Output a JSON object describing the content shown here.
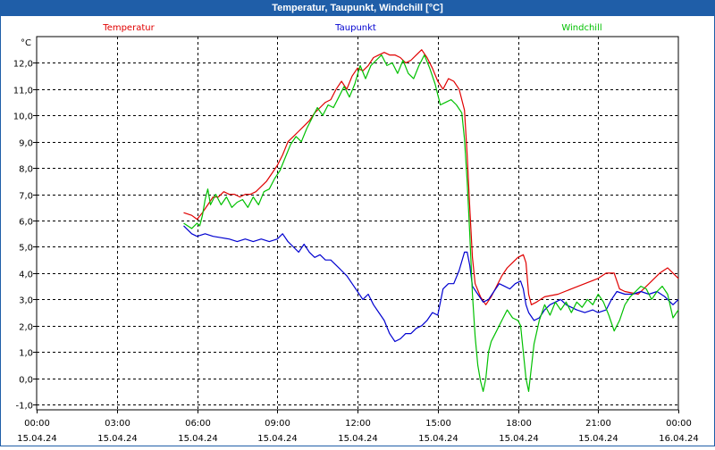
{
  "window": {
    "title": "Temperatur, Taupunkt, Windchill [°C]"
  },
  "chart_data": {
    "type": "line",
    "title": "Temperatur, Taupunkt, Windchill [°C]",
    "y_unit": "°C",
    "ylim": [
      -1.2,
      13.0
    ],
    "yticks": [
      -1.0,
      0.0,
      1.0,
      2.0,
      3.0,
      4.0,
      5.0,
      6.0,
      7.0,
      8.0,
      9.0,
      10.0,
      11.0,
      12.0
    ],
    "ytick_labels": [
      "-1,0",
      "0,0",
      "1,0",
      "2,0",
      "3,0",
      "4,0",
      "5,0",
      "6,0",
      "7,0",
      "8,0",
      "9,0",
      "10,0",
      "11,0",
      "12,0"
    ],
    "xlim": [
      0,
      24
    ],
    "xticks": [
      0,
      3,
      6,
      9,
      12,
      15,
      18,
      21,
      24
    ],
    "xtick_labels": [
      [
        "00:00",
        "15.04.24"
      ],
      [
        "03:00",
        "15.04.24"
      ],
      [
        "06:00",
        "15.04.24"
      ],
      [
        "09:00",
        "15.04.24"
      ],
      [
        "12:00",
        "15.04.24"
      ],
      [
        "15:00",
        "15.04.24"
      ],
      [
        "18:00",
        "15.04.24"
      ],
      [
        "21:00",
        "15.04.24"
      ],
      [
        "00:00",
        "16.04.24"
      ]
    ],
    "grid": true,
    "legend": "top",
    "series": [
      {
        "name": "Temperatur",
        "color": "#e00000",
        "points": [
          [
            5.5,
            6.3
          ],
          [
            5.8,
            6.2
          ],
          [
            6.0,
            6.05
          ],
          [
            6.2,
            6.3
          ],
          [
            6.4,
            6.6
          ],
          [
            6.6,
            6.9
          ],
          [
            6.8,
            6.9
          ],
          [
            7.0,
            7.1
          ],
          [
            7.2,
            7.0
          ],
          [
            7.4,
            7.0
          ],
          [
            7.6,
            6.9
          ],
          [
            7.8,
            7.0
          ],
          [
            8.0,
            7.0
          ],
          [
            8.2,
            7.1
          ],
          [
            8.4,
            7.3
          ],
          [
            8.6,
            7.5
          ],
          [
            8.8,
            7.8
          ],
          [
            9.0,
            8.1
          ],
          [
            9.2,
            8.5
          ],
          [
            9.4,
            9.0
          ],
          [
            9.6,
            9.2
          ],
          [
            9.8,
            9.4
          ],
          [
            10.0,
            9.6
          ],
          [
            10.2,
            9.8
          ],
          [
            10.4,
            10.1
          ],
          [
            10.6,
            10.3
          ],
          [
            10.8,
            10.5
          ],
          [
            11.0,
            10.6
          ],
          [
            11.2,
            11.0
          ],
          [
            11.4,
            11.3
          ],
          [
            11.6,
            11.0
          ],
          [
            11.8,
            11.5
          ],
          [
            12.0,
            11.8
          ],
          [
            12.2,
            11.7
          ],
          [
            12.4,
            11.9
          ],
          [
            12.6,
            12.2
          ],
          [
            12.8,
            12.3
          ],
          [
            13.0,
            12.4
          ],
          [
            13.2,
            12.3
          ],
          [
            13.4,
            12.3
          ],
          [
            13.6,
            12.2
          ],
          [
            13.8,
            12.0
          ],
          [
            14.0,
            12.1
          ],
          [
            14.2,
            12.3
          ],
          [
            14.4,
            12.5
          ],
          [
            14.6,
            12.2
          ],
          [
            14.8,
            11.8
          ],
          [
            15.0,
            11.3
          ],
          [
            15.2,
            11.0
          ],
          [
            15.4,
            11.4
          ],
          [
            15.6,
            11.3
          ],
          [
            15.8,
            11.0
          ],
          [
            16.0,
            10.2
          ],
          [
            16.1,
            8.5
          ],
          [
            16.2,
            6.5
          ],
          [
            16.3,
            4.6
          ],
          [
            16.4,
            3.6
          ],
          [
            16.6,
            3.1
          ],
          [
            16.8,
            2.8
          ],
          [
            17.0,
            3.1
          ],
          [
            17.2,
            3.5
          ],
          [
            17.4,
            3.9
          ],
          [
            17.6,
            4.2
          ],
          [
            17.8,
            4.4
          ],
          [
            18.0,
            4.6
          ],
          [
            18.2,
            4.7
          ],
          [
            18.3,
            4.4
          ],
          [
            18.4,
            3.2
          ],
          [
            18.5,
            2.8
          ],
          [
            18.7,
            2.9
          ],
          [
            19.0,
            3.1
          ],
          [
            19.5,
            3.2
          ],
          [
            20.0,
            3.4
          ],
          [
            20.5,
            3.6
          ],
          [
            21.0,
            3.8
          ],
          [
            21.3,
            4.0
          ],
          [
            21.6,
            4.0
          ],
          [
            21.8,
            3.4
          ],
          [
            22.0,
            3.3
          ],
          [
            22.5,
            3.2
          ],
          [
            23.0,
            3.7
          ],
          [
            23.3,
            4.0
          ],
          [
            23.6,
            4.2
          ],
          [
            23.8,
            4.0
          ],
          [
            24.0,
            3.8
          ]
        ]
      },
      {
        "name": "Taupunkt",
        "color": "#0000d0",
        "points": [
          [
            5.5,
            5.8
          ],
          [
            5.8,
            5.5
          ],
          [
            6.0,
            5.4
          ],
          [
            6.3,
            5.5
          ],
          [
            6.6,
            5.4
          ],
          [
            6.9,
            5.35
          ],
          [
            7.2,
            5.3
          ],
          [
            7.5,
            5.2
          ],
          [
            7.8,
            5.3
          ],
          [
            8.1,
            5.2
          ],
          [
            8.4,
            5.3
          ],
          [
            8.7,
            5.2
          ],
          [
            9.0,
            5.3
          ],
          [
            9.2,
            5.5
          ],
          [
            9.4,
            5.2
          ],
          [
            9.6,
            5.0
          ],
          [
            9.8,
            4.8
          ],
          [
            10.0,
            5.1
          ],
          [
            10.2,
            4.8
          ],
          [
            10.4,
            4.6
          ],
          [
            10.6,
            4.7
          ],
          [
            10.8,
            4.5
          ],
          [
            11.0,
            4.5
          ],
          [
            11.2,
            4.3
          ],
          [
            11.4,
            4.1
          ],
          [
            11.6,
            3.9
          ],
          [
            11.8,
            3.6
          ],
          [
            12.0,
            3.3
          ],
          [
            12.2,
            3.0
          ],
          [
            12.4,
            3.2
          ],
          [
            12.6,
            2.8
          ],
          [
            12.8,
            2.5
          ],
          [
            13.0,
            2.2
          ],
          [
            13.2,
            1.7
          ],
          [
            13.4,
            1.4
          ],
          [
            13.6,
            1.5
          ],
          [
            13.8,
            1.7
          ],
          [
            14.0,
            1.7
          ],
          [
            14.2,
            1.9
          ],
          [
            14.4,
            2.0
          ],
          [
            14.6,
            2.2
          ],
          [
            14.8,
            2.5
          ],
          [
            15.0,
            2.4
          ],
          [
            15.2,
            3.4
          ],
          [
            15.4,
            3.6
          ],
          [
            15.6,
            3.6
          ],
          [
            15.8,
            4.1
          ],
          [
            16.0,
            4.8
          ],
          [
            16.1,
            4.8
          ],
          [
            16.2,
            4.3
          ],
          [
            16.3,
            3.5
          ],
          [
            16.5,
            3.2
          ],
          [
            16.7,
            2.9
          ],
          [
            16.9,
            3.0
          ],
          [
            17.1,
            3.3
          ],
          [
            17.3,
            3.6
          ],
          [
            17.5,
            3.5
          ],
          [
            17.7,
            3.4
          ],
          [
            17.9,
            3.6
          ],
          [
            18.1,
            3.7
          ],
          [
            18.2,
            3.4
          ],
          [
            18.3,
            2.8
          ],
          [
            18.4,
            2.5
          ],
          [
            18.6,
            2.2
          ],
          [
            18.8,
            2.3
          ],
          [
            19.0,
            2.6
          ],
          [
            19.2,
            2.8
          ],
          [
            19.4,
            2.9
          ],
          [
            19.6,
            3.0
          ],
          [
            19.8,
            2.8
          ],
          [
            20.0,
            2.7
          ],
          [
            20.2,
            2.6
          ],
          [
            20.5,
            2.5
          ],
          [
            20.8,
            2.6
          ],
          [
            21.0,
            2.5
          ],
          [
            21.3,
            2.6
          ],
          [
            21.5,
            3.0
          ],
          [
            21.7,
            3.3
          ],
          [
            22.0,
            3.2
          ],
          [
            22.3,
            3.2
          ],
          [
            22.6,
            3.3
          ],
          [
            22.9,
            3.2
          ],
          [
            23.2,
            3.3
          ],
          [
            23.5,
            3.1
          ],
          [
            23.8,
            2.8
          ],
          [
            24.0,
            3.0
          ]
        ]
      },
      {
        "name": "Windchill",
        "color": "#00c000",
        "points": [
          [
            5.5,
            5.9
          ],
          [
            5.8,
            5.7
          ],
          [
            6.0,
            5.9
          ],
          [
            6.1,
            5.8
          ],
          [
            6.2,
            6.2
          ],
          [
            6.3,
            6.8
          ],
          [
            6.4,
            7.2
          ],
          [
            6.5,
            6.6
          ],
          [
            6.7,
            7.0
          ],
          [
            6.9,
            6.6
          ],
          [
            7.1,
            6.9
          ],
          [
            7.3,
            6.5
          ],
          [
            7.5,
            6.7
          ],
          [
            7.7,
            6.8
          ],
          [
            7.9,
            6.5
          ],
          [
            8.1,
            6.9
          ],
          [
            8.3,
            6.6
          ],
          [
            8.5,
            7.1
          ],
          [
            8.7,
            7.2
          ],
          [
            8.9,
            7.6
          ],
          [
            9.1,
            7.9
          ],
          [
            9.3,
            8.4
          ],
          [
            9.5,
            8.9
          ],
          [
            9.7,
            9.2
          ],
          [
            9.9,
            9.0
          ],
          [
            10.1,
            9.5
          ],
          [
            10.3,
            9.9
          ],
          [
            10.5,
            10.3
          ],
          [
            10.7,
            10.0
          ],
          [
            10.9,
            10.4
          ],
          [
            11.1,
            10.3
          ],
          [
            11.3,
            10.7
          ],
          [
            11.5,
            11.1
          ],
          [
            11.7,
            10.7
          ],
          [
            11.9,
            11.2
          ],
          [
            12.1,
            11.9
          ],
          [
            12.3,
            11.4
          ],
          [
            12.5,
            11.9
          ],
          [
            12.7,
            12.1
          ],
          [
            12.9,
            12.3
          ],
          [
            13.1,
            11.9
          ],
          [
            13.3,
            12.0
          ],
          [
            13.5,
            11.6
          ],
          [
            13.7,
            12.1
          ],
          [
            13.9,
            11.6
          ],
          [
            14.1,
            11.4
          ],
          [
            14.3,
            11.9
          ],
          [
            14.5,
            12.3
          ],
          [
            14.7,
            11.8
          ],
          [
            14.9,
            11.2
          ],
          [
            15.1,
            10.4
          ],
          [
            15.3,
            10.5
          ],
          [
            15.5,
            10.6
          ],
          [
            15.7,
            10.4
          ],
          [
            15.9,
            10.1
          ],
          [
            16.0,
            9.1
          ],
          [
            16.1,
            7.5
          ],
          [
            16.2,
            5.5
          ],
          [
            16.3,
            3.2
          ],
          [
            16.4,
            1.6
          ],
          [
            16.5,
            0.5
          ],
          [
            16.6,
            -0.1
          ],
          [
            16.7,
            -0.5
          ],
          [
            16.8,
            0.0
          ],
          [
            16.9,
            1.0
          ],
          [
            17.0,
            1.4
          ],
          [
            17.2,
            1.8
          ],
          [
            17.4,
            2.2
          ],
          [
            17.6,
            2.6
          ],
          [
            17.8,
            2.3
          ],
          [
            18.0,
            2.2
          ],
          [
            18.1,
            2.0
          ],
          [
            18.2,
            1.0
          ],
          [
            18.3,
            0.0
          ],
          [
            18.4,
            -0.5
          ],
          [
            18.5,
            0.4
          ],
          [
            18.6,
            1.3
          ],
          [
            18.8,
            2.2
          ],
          [
            19.0,
            2.8
          ],
          [
            19.2,
            2.4
          ],
          [
            19.4,
            2.9
          ],
          [
            19.6,
            2.6
          ],
          [
            19.8,
            2.9
          ],
          [
            20.0,
            2.5
          ],
          [
            20.2,
            2.9
          ],
          [
            20.4,
            2.7
          ],
          [
            20.6,
            3.0
          ],
          [
            20.8,
            2.8
          ],
          [
            21.0,
            3.2
          ],
          [
            21.2,
            2.9
          ],
          [
            21.4,
            2.4
          ],
          [
            21.6,
            1.8
          ],
          [
            21.8,
            2.2
          ],
          [
            22.0,
            2.8
          ],
          [
            22.2,
            3.1
          ],
          [
            22.4,
            3.3
          ],
          [
            22.6,
            3.5
          ],
          [
            22.8,
            3.4
          ],
          [
            23.0,
            3.0
          ],
          [
            23.2,
            3.3
          ],
          [
            23.4,
            3.5
          ],
          [
            23.6,
            3.2
          ],
          [
            23.8,
            2.3
          ],
          [
            24.0,
            2.6
          ]
        ]
      }
    ]
  }
}
